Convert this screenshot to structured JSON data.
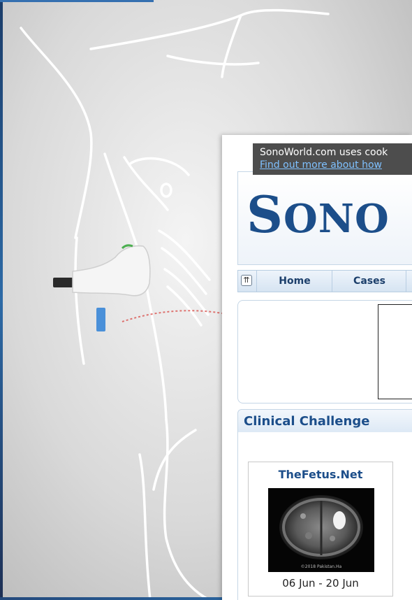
{
  "cookie_notice": {
    "text": "SonoWorld.com uses cook",
    "link": "Find out more about how"
  },
  "site": {
    "logo_big": "S",
    "logo_rest": "ONO"
  },
  "nav": {
    "collapse_icon": "double-chevron-up-icon",
    "items": [
      {
        "label": "Home"
      },
      {
        "label": "Cases"
      }
    ]
  },
  "section": {
    "title": "Clinical Challenge"
  },
  "card": {
    "title": "TheFetus.Net",
    "image_caption": "©2018 Pakistan.Ha",
    "date": "06 Jun - 20 Jun"
  },
  "colors": {
    "brand_blue": "#1c4e8a",
    "probe_marker": "#4a90d9",
    "scan_arc": "#d9534f"
  }
}
